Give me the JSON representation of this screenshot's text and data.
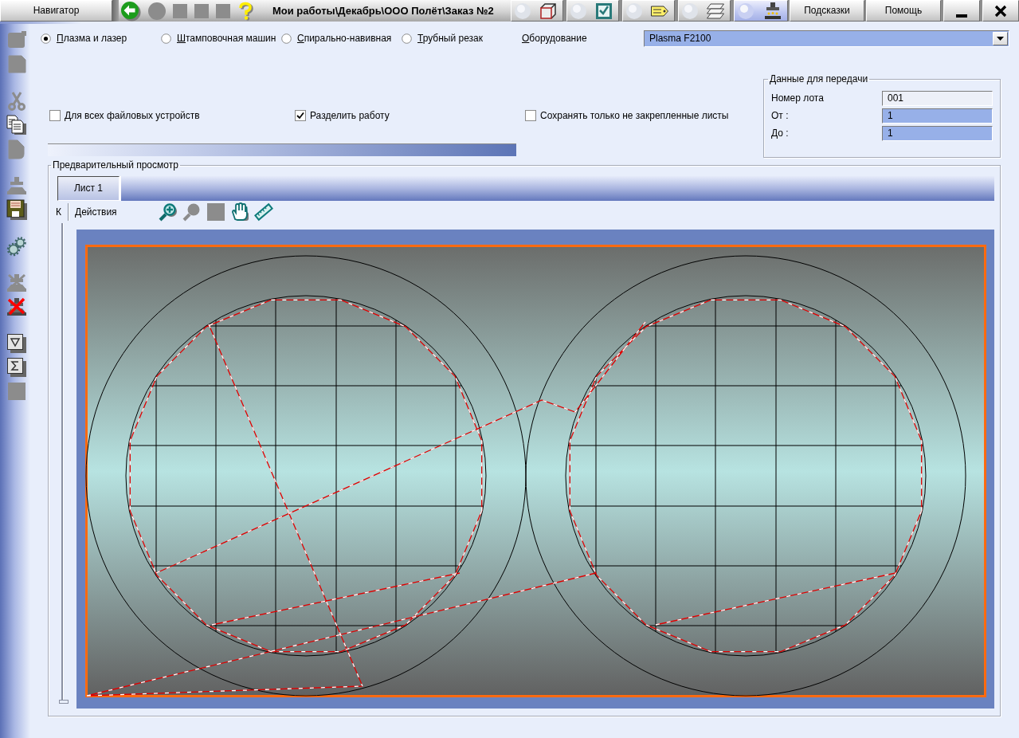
{
  "title_bar": {
    "navigator_button": "Навигатор",
    "nav_tools": [
      {
        "kind": "back",
        "disabled": false
      },
      {
        "kind": "circle",
        "disabled": true
      },
      {
        "kind": "square",
        "disabled": true
      },
      {
        "kind": "square",
        "disabled": true
      },
      {
        "kind": "square",
        "disabled": true
      },
      {
        "kind": "help",
        "disabled": false
      }
    ],
    "title": "Мои работы\\Декабрь\\ООО Полёт\\Заказ №2",
    "mode_tabs": [
      {
        "kind": "cube",
        "selected": false
      },
      {
        "kind": "checklist",
        "selected": false
      },
      {
        "kind": "tag",
        "selected": false
      },
      {
        "kind": "sheets",
        "selected": false
      },
      {
        "kind": "press",
        "selected": true
      }
    ],
    "buttons": [
      "Подсказки",
      "Помощь"
    ],
    "window_controls": [
      {
        "kind": "minimize"
      },
      {
        "kind": "close"
      }
    ]
  },
  "left_toolbar": [
    {
      "items": [
        {
          "kind": "window",
          "disabled": true
        },
        {
          "kind": "document",
          "disabled": true
        }
      ]
    },
    {
      "items": [
        {
          "kind": "scissors",
          "disabled": true
        },
        {
          "kind": "copy",
          "disabled": false
        },
        {
          "kind": "page",
          "disabled": true
        }
      ]
    },
    {
      "items": [
        {
          "kind": "press",
          "disabled": true
        },
        {
          "kind": "save",
          "disabled": false
        }
      ]
    },
    {
      "items": [
        {
          "kind": "gears",
          "disabled": false
        }
      ]
    },
    {
      "items": [
        {
          "kind": "press-cross",
          "disabled": true
        },
        {
          "kind": "press-delete",
          "disabled": false
        }
      ]
    },
    {
      "items": [
        {
          "kind": "filter",
          "disabled": false
        },
        {
          "kind": "sigma",
          "disabled": false
        },
        {
          "kind": "square",
          "disabled": true
        }
      ]
    }
  ],
  "machine_types": [
    {
      "label": "Плазма и лазер",
      "selected": true
    },
    {
      "label": "Штамповочная машин",
      "selected": false
    },
    {
      "label": "Спирально-навивная",
      "selected": false
    },
    {
      "label": "Трубный резак",
      "selected": false
    }
  ],
  "equipment": {
    "label": "Оборудование",
    "value": "Plasma F2100"
  },
  "options": [
    {
      "label": "Для всех файловых устройств",
      "checked": false
    },
    {
      "label": "Разделить работу",
      "checked": true
    },
    {
      "label": "Сохранять только не закрепленные листы",
      "checked": false
    }
  ],
  "progress": {
    "level": 1
  },
  "transfer_data": {
    "title": "Данные для передачи",
    "fields": [
      {
        "label": "Номер лота",
        "value": "001",
        "highlighted": false
      },
      {
        "label": "От :",
        "value": "1",
        "highlighted": true
      },
      {
        "label": "До :",
        "value": "1",
        "highlighted": true
      }
    ]
  },
  "preview": {
    "title": "Предварительный просмотр",
    "sheet_tabs": [
      {
        "label": "Лист 1",
        "selected": true
      }
    ],
    "panel_tabs": [
      {
        "label": "К",
        "selected": true
      },
      {
        "label": "Действия",
        "selected": false
      }
    ],
    "tools": [
      {
        "kind": "zoom-in",
        "disabled": false
      },
      {
        "kind": "magnifier",
        "disabled": true
      },
      {
        "kind": "square",
        "disabled": true
      },
      {
        "kind": "hand",
        "disabled": false
      },
      {
        "kind": "ruler",
        "disabled": false
      }
    ]
  }
}
